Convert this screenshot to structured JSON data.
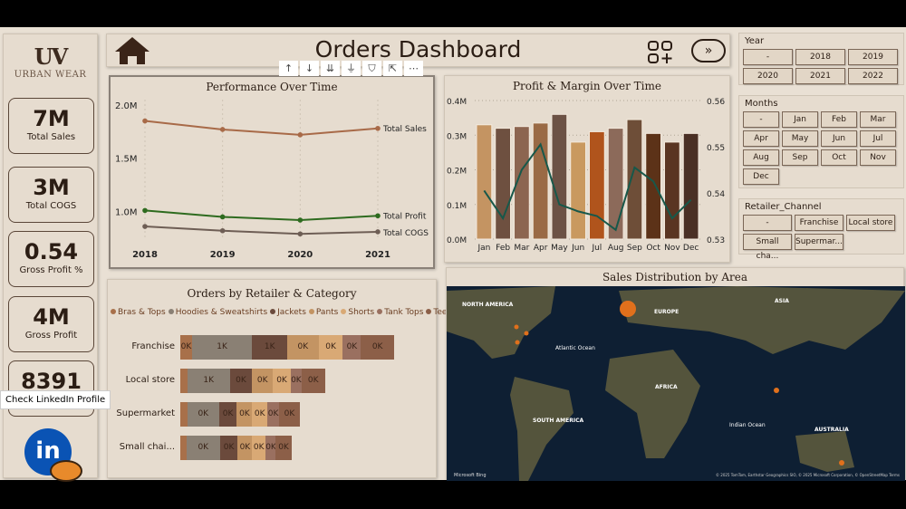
{
  "brand": {
    "logo": "UV",
    "name": "URBAN WEAR"
  },
  "kpis": [
    {
      "value": "7M",
      "label": "Total Sales"
    },
    {
      "value": "3M",
      "label": "Total COGS"
    },
    {
      "value": "0.54",
      "label": "Gross Profit %"
    },
    {
      "value": "4M",
      "label": "Gross Profit"
    },
    {
      "value": "8391",
      "label": ""
    }
  ],
  "tooltip": "Check LinkedIn Profile",
  "linkedin": "in",
  "header": {
    "title": "Orders Dashboard",
    "next": "»"
  },
  "toolbar": [
    "↑",
    "↓",
    "⇊",
    "⏚",
    "⛉",
    "⇱",
    "⋯"
  ],
  "slicers": {
    "year": {
      "title": "Year",
      "options": [
        "-",
        "2018",
        "2019",
        "2020",
        "2021",
        "2022"
      ]
    },
    "months": {
      "title": "Months",
      "options": [
        "-",
        "Jan",
        "Feb",
        "Mar",
        "Apr",
        "May",
        "Jun",
        "Jul",
        "Aug",
        "Sep",
        "Oct",
        "Nov",
        "Dec"
      ]
    },
    "channel": {
      "title": "Retailer_Channel",
      "options": [
        "-",
        "Franchise",
        "Local store",
        "Small cha...",
        "Supermar..."
      ]
    }
  },
  "map": {
    "title": "Sales Distribution by Area",
    "labels": [
      "NORTH AMERICA",
      "EUROPE",
      "ASIA",
      "Atlantic Ocean",
      "AFRICA",
      "SOUTH AMERICA",
      "Indian Ocean",
      "AUSTRALIA"
    ],
    "bing": "Microsoft Bing",
    "credit": "© 2025 TomTom, Earthstar Geographics SIO, © 2025 Microsoft Corporation, © OpenStreetMap  Terms"
  },
  "chart_data": [
    {
      "type": "line",
      "title": "Performance Over Time",
      "x": [
        "2018",
        "2019",
        "2020",
        "2021"
      ],
      "yticks": [
        "1.0M",
        "1.5M",
        "2.0M"
      ],
      "ylim": [
        0.75,
        2.05
      ],
      "series": [
        {
          "name": "Total Sales",
          "values": [
            1.85,
            1.77,
            1.72,
            1.78
          ],
          "color": "#a86a48"
        },
        {
          "name": "Total Profit",
          "values": [
            1.01,
            0.95,
            0.92,
            0.96
          ],
          "color": "#2e6b1f"
        },
        {
          "name": "Total COGS",
          "values": [
            0.86,
            0.82,
            0.79,
            0.81
          ],
          "color": "#6e5e55"
        }
      ]
    },
    {
      "type": "bar",
      "title": "Profit & Margin Over Time",
      "categories": [
        "Jan",
        "Feb",
        "Mar",
        "Apr",
        "May",
        "Jun",
        "Jul",
        "Aug",
        "Sep",
        "Oct",
        "Nov",
        "Dec"
      ],
      "values": [
        0.33,
        0.32,
        0.325,
        0.335,
        0.36,
        0.28,
        0.31,
        0.32,
        0.345,
        0.305,
        0.28,
        0.305
      ],
      "colors": [
        "#c49462",
        "#6e5040",
        "#8c6550",
        "#9a6a45",
        "#6c5245",
        "#c9995f",
        "#b0541c",
        "#8c6a5a",
        "#6e4e38",
        "#5c3218",
        "#5a3522",
        "#4a3025"
      ],
      "ylim": [
        0,
        0.4
      ],
      "yticks": [
        "0.0M",
        "0.1M",
        "0.2M",
        "0.3M",
        "0.4M"
      ],
      "line": {
        "values": [
          0.5405,
          0.5345,
          0.545,
          0.5505,
          0.5375,
          0.536,
          0.535,
          0.532,
          0.5455,
          0.5425,
          0.5345,
          0.5385
        ],
        "color": "#17584a",
        "ylim": [
          0.53,
          0.56
        ],
        "yticks": [
          "0.53",
          "0.54",
          "0.55",
          "0.56"
        ]
      }
    },
    {
      "type": "bar",
      "title": "Orders by Retailer & Category",
      "orientation": "horizontal-stacked",
      "legend": [
        "Bras & Tops",
        "Hoodies & Sweatshirts",
        "Jackets",
        "Pants",
        "Shorts",
        "Tank Tops",
        "Tees"
      ],
      "colors": [
        "#a8704a",
        "#8a8074",
        "#6b4a3c",
        "#c39463",
        "#d9a975",
        "#9a7060",
        "#8c5f48"
      ],
      "categories": [
        "Franchise",
        "Local store",
        "Supermarket",
        "Small chai..."
      ],
      "values": [
        [
          130,
          670,
          390,
          350,
          270,
          200,
          370
        ],
        [
          80,
          470,
          250,
          230,
          200,
          120,
          260
        ],
        [
          80,
          350,
          200,
          170,
          170,
          130,
          230
        ],
        [
          70,
          370,
          200,
          160,
          150,
          110,
          180
        ]
      ],
      "labels": [
        [
          "0K",
          "1K",
          "1K",
          "0K",
          "0K",
          "0K",
          "0K"
        ],
        [
          "",
          "1K",
          "0K",
          "0K",
          "0K",
          "0K",
          "0K"
        ],
        [
          "",
          "0K",
          "0K",
          "0K",
          "0K",
          "0K",
          "0K"
        ],
        [
          "",
          "0K",
          "0K",
          "0K",
          "0K",
          "0K",
          "0K"
        ]
      ]
    }
  ]
}
